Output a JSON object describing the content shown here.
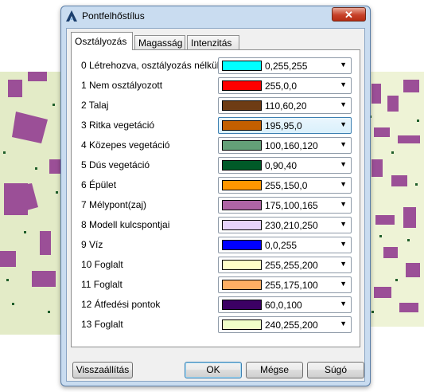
{
  "window": {
    "title": "Pontfelhőstílus",
    "close_label": "✕",
    "icon": "autocad-icon"
  },
  "tabs": [
    {
      "label": "Osztályozás",
      "active": true
    },
    {
      "label": "Magasság",
      "active": false
    },
    {
      "label": "Intenzitás",
      "active": false
    }
  ],
  "classes": [
    {
      "label": "0 Létrehozva, osztályozás nélkül",
      "value": "0,255,255",
      "color": "#00ffff"
    },
    {
      "label": "1 Nem osztályozott",
      "value": "255,0,0",
      "color": "#ff0000"
    },
    {
      "label": "2 Talaj",
      "value": "110,60,20",
      "color": "#6e3c14"
    },
    {
      "label": "3 Ritka vegetáció",
      "value": "195,95,0",
      "color": "#c35f00",
      "hover": true
    },
    {
      "label": "4 Közepes vegetáció",
      "value": "100,160,120",
      "color": "#64a078"
    },
    {
      "label": "5 Dús vegetáció",
      "value": "0,90,40",
      "color": "#005a28"
    },
    {
      "label": "6 Épület",
      "value": "255,150,0",
      "color": "#ff9600"
    },
    {
      "label": "7 Mélypont(zaj)",
      "value": "175,100,165",
      "color": "#af64a5"
    },
    {
      "label": "8 Modell kulcspontjai",
      "value": "230,210,250",
      "color": "#e6d2fa"
    },
    {
      "label": "9 Víz",
      "value": "0,0,255",
      "color": "#0000ff"
    },
    {
      "label": "10 Foglalt",
      "value": "255,255,200",
      "color": "#ffffc8"
    },
    {
      "label": "11 Foglalt",
      "value": "255,175,100",
      "color": "#ffaf64"
    },
    {
      "label": "12 Átfedési pontok",
      "value": "60,0,100",
      "color": "#3c0064"
    },
    {
      "label": "13 Foglalt",
      "value": "240,255,200",
      "color": "#f0ffc8"
    }
  ],
  "buttons": {
    "reset": "Visszaállítás",
    "ok": "OK",
    "cancel": "Mégse",
    "help": "Súgó"
  }
}
